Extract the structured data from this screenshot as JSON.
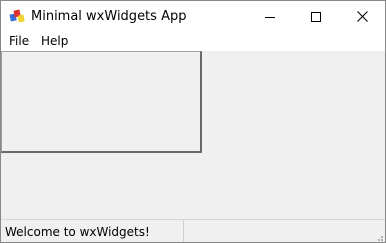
{
  "window": {
    "title": "Minimal wxWidgets App",
    "app_icon": "wxwidgets-logo-icon",
    "controls": {
      "minimize_icon": "minimize-icon",
      "maximize_icon": "maximize-icon",
      "close_icon": "close-icon"
    }
  },
  "menubar": {
    "items": [
      {
        "label": "File"
      },
      {
        "label": "Help"
      }
    ]
  },
  "statusbar": {
    "fields": [
      {
        "text": "Welcome to wxWidgets!"
      },
      {
        "text": ""
      }
    ],
    "grip_icon": "size-grip-icon"
  },
  "colors": {
    "client_background": "#f0f0f0",
    "titlebar_background": "#ffffff",
    "panel_shadow": "#696969"
  }
}
